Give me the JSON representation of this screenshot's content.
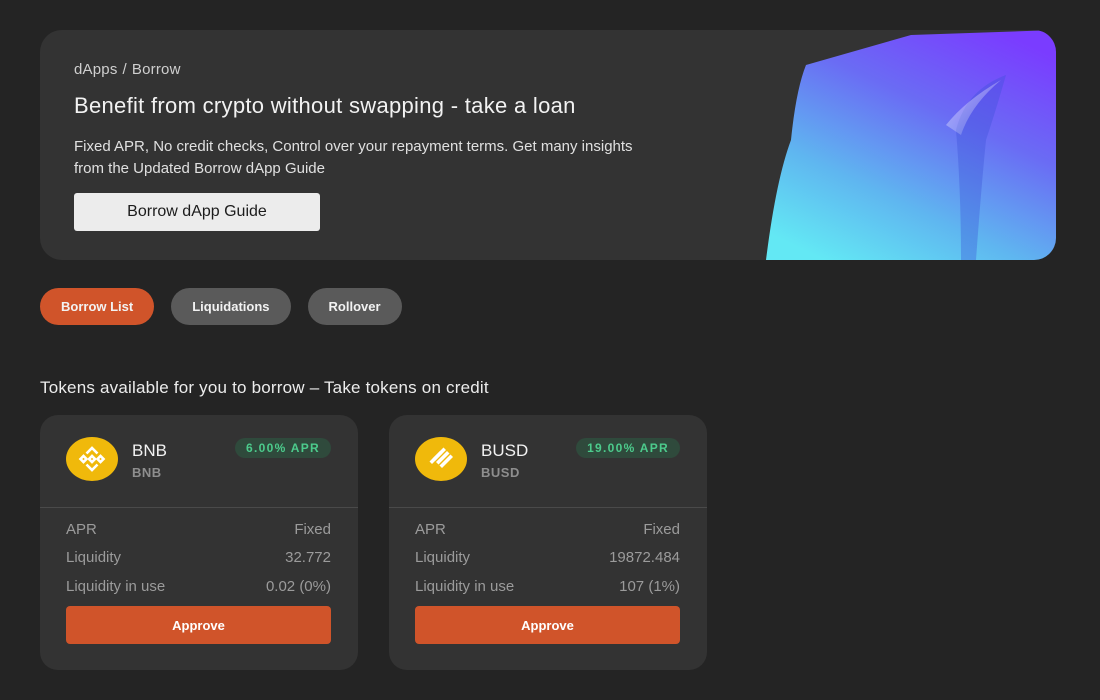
{
  "breadcrumb": {
    "root": "dApps",
    "separator": "/",
    "current": "Borrow"
  },
  "hero": {
    "title": "Benefit from crypto without swapping - take a loan",
    "description": "Fixed APR, No credit checks, Control over your repayment terms. Get many insights from the Updated Borrow dApp Guide",
    "guide_button": "Borrow dApp Guide"
  },
  "tabs": [
    {
      "label": "Borrow List",
      "active": true
    },
    {
      "label": "Liquidations",
      "active": false
    },
    {
      "label": "Rollover",
      "active": false
    }
  ],
  "section_title": "Tokens available for you to borrow – Take tokens on credit",
  "colors": {
    "accent": "#d0542a",
    "apr_green": "#4ccb8c",
    "coin_gold": "#f0b90b",
    "background": "#242424",
    "card": "#333333"
  },
  "cards": [
    {
      "icon": "bnb-coin-icon",
      "symbol": "BNB",
      "subsymbol": "BNB",
      "apr_badge": "6.00% APR",
      "rows": [
        {
          "label": "APR",
          "value": "Fixed"
        },
        {
          "label": "Liquidity",
          "value": "32.772"
        },
        {
          "label": "Liquidity in use",
          "value": "0.02 (0%)"
        }
      ],
      "button": "Approve"
    },
    {
      "icon": "busd-coin-icon",
      "symbol": "BUSD",
      "subsymbol": "BUSD",
      "apr_badge": "19.00% APR",
      "rows": [
        {
          "label": "APR",
          "value": "Fixed"
        },
        {
          "label": "Liquidity",
          "value": "19872.484"
        },
        {
          "label": "Liquidity in use",
          "value": "107 (1%)"
        }
      ],
      "button": "Approve"
    }
  ]
}
